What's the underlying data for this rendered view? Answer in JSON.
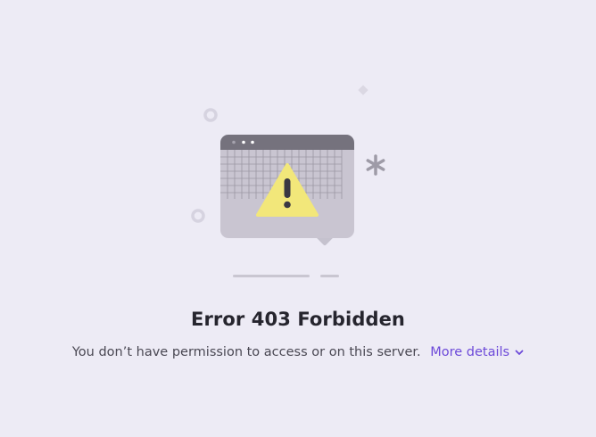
{
  "error": {
    "title": "Error 403 Forbidden",
    "message": "You don’t have permission to access or on this server.",
    "more_details_label": "More details"
  },
  "icons": {
    "illustration": "browser-window-warning-icon",
    "warning": "warning-triangle-icon",
    "expand": "chevron-down-icon"
  },
  "colors": {
    "background": "#edebf5",
    "accent": "#6d4ad9",
    "warning": "#f2e77a"
  }
}
